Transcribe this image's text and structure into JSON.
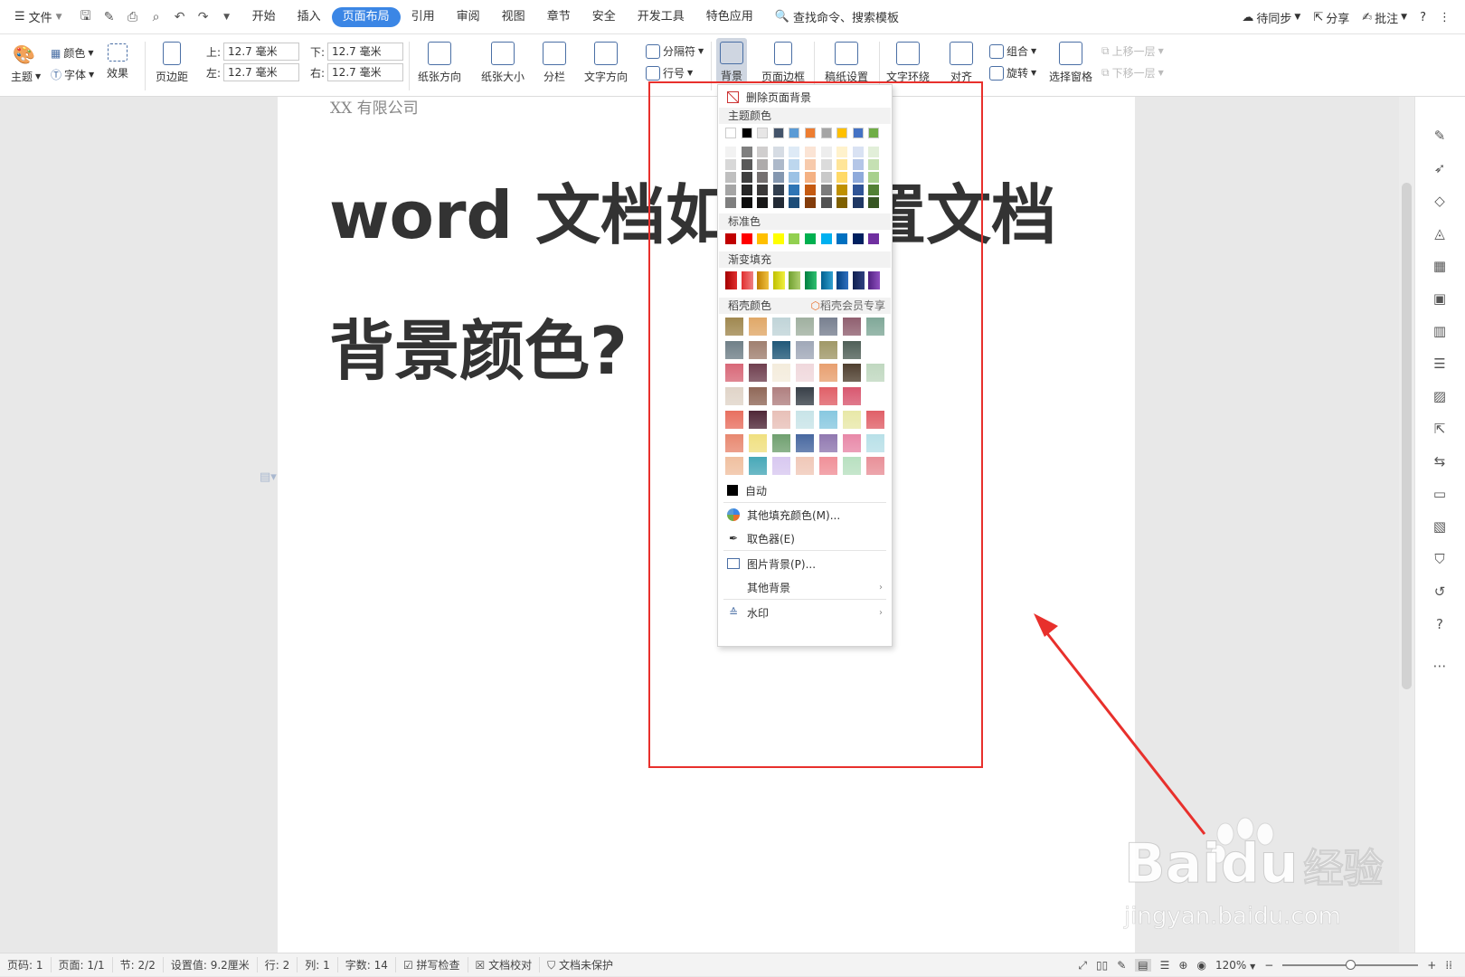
{
  "menubar": {
    "file_label": "文件",
    "tabs": [
      "开始",
      "插入",
      "页面布局",
      "引用",
      "审阅",
      "视图",
      "章节",
      "安全",
      "开发工具",
      "特色应用"
    ],
    "active_tab": "页面布局",
    "search_label": "查找命令、搜索模板",
    "right": {
      "sync": "待同步",
      "share": "分享",
      "comment": "批注",
      "help": "?",
      "more": "⋮"
    }
  },
  "ribbon": {
    "theme": "主题",
    "color": "颜色",
    "font": "字体",
    "effect": "效果",
    "margins": "页边距",
    "top_label": "上:",
    "top_value": "12.7 毫米",
    "bottom_label": "下:",
    "bottom_value": "12.7 毫米",
    "left_label": "左:",
    "left_value": "12.7 毫米",
    "right_label": "右:",
    "right_value": "12.7 毫米",
    "orientation": "纸张方向",
    "size": "纸张大小",
    "columns": "分栏",
    "text_direction": "文字方向",
    "separator": "分隔符",
    "line_number": "行号",
    "background": "背景",
    "page_border": "页面边框",
    "draft_settings": "稿纸设置",
    "text_wrap": "文字环绕",
    "align": "对齐",
    "group": "组合",
    "rotate": "旋转",
    "selection_pane": "选择窗格",
    "bring_forward": "上移一层",
    "send_backward": "下移一层"
  },
  "document": {
    "company": "XX 有限公司",
    "title_line1": "word 文档如何设置文档",
    "title_line2": "背景颜色?"
  },
  "dropdown": {
    "delete_bg": "删除页面背景",
    "theme_colors_head": "主题颜色",
    "standard_head": "标准色",
    "gradient_head": "渐变填充",
    "docer_head": "稻壳颜色",
    "docer_vip": "稻壳会员专享",
    "auto": "自动",
    "more_fill": "其他填充颜色(M)...",
    "eyedropper": "取色器(E)",
    "picture_bg": "图片背景(P)...",
    "other_bg": "其他背景",
    "watermark": "水印",
    "theme_top_row": [
      "#ffffff",
      "#000000",
      "#e7e6e6",
      "#44546a",
      "#5b9bd5",
      "#ed7d31",
      "#a5a5a5",
      "#ffc000",
      "#4472c4",
      "#70ad47"
    ],
    "theme_shades": [
      [
        "#f2f2f2",
        "#7f7f7f",
        "#d0cece",
        "#d6dce4",
        "#deeaf6",
        "#fbe4d5",
        "#ededed",
        "#fff2cc",
        "#d9e2f3",
        "#e2efd9"
      ],
      [
        "#d8d8d8",
        "#595959",
        "#aeabab",
        "#adb9ca",
        "#bdd7ee",
        "#f7caac",
        "#dbdbdb",
        "#ffe599",
        "#b4c6e7",
        "#c5e0b3"
      ],
      [
        "#bfbfbf",
        "#3f3f3f",
        "#757070",
        "#8497b0",
        "#9cc2e5",
        "#f4b183",
        "#c9c9c9",
        "#ffd966",
        "#8eaadb",
        "#a8d08d"
      ],
      [
        "#a5a5a5",
        "#262626",
        "#3a3838",
        "#323f4f",
        "#2e75b5",
        "#c55a11",
        "#7b7b7b",
        "#bf9000",
        "#2f5496",
        "#538135"
      ],
      [
        "#7f7f7f",
        "#0c0c0c",
        "#171616",
        "#222a35",
        "#1e4e79",
        "#833c0b",
        "#525252",
        "#7f6000",
        "#1f3864",
        "#375623"
      ]
    ],
    "standard_colors": [
      "#c00000",
      "#ff0000",
      "#ffc000",
      "#ffff00",
      "#92d050",
      "#00b050",
      "#00b0f0",
      "#0070c0",
      "#002060",
      "#7030a0"
    ],
    "gradient_colors": [
      [
        "#a50000",
        "#e03030"
      ],
      [
        "#e03030",
        "#f08080"
      ],
      [
        "#c08000",
        "#f0c040"
      ],
      [
        "#c0c000",
        "#f0f040"
      ],
      [
        "#70a030",
        "#b0d070"
      ],
      [
        "#008040",
        "#30c070"
      ],
      [
        "#006090",
        "#30a0d0"
      ],
      [
        "#004080",
        "#3070c0"
      ],
      [
        "#102050",
        "#304080"
      ],
      [
        "#502080",
        "#9050c0"
      ]
    ],
    "docer_colors": [
      [
        "#a08850",
        "#e0a868",
        "#c0d4d8",
        "#a0b0a0",
        "#788090",
        "#906070",
        "#80a898"
      ],
      [
        "#708088",
        "#a08070",
        "#205878",
        "#a0a8b8",
        "#a09868",
        "#506058"
      ],
      [
        "#d86878",
        "#704050",
        "#f4ecdc",
        "#f0d8dc",
        "#e8a070",
        "#504030",
        "#c0d8c0"
      ],
      [
        "#e0d4c8",
        "#906858",
        "#b08080",
        "#384048",
        "#e06068",
        "#d85870"
      ],
      [
        "#e87060",
        "#502838",
        "#e8c0b8",
        "#c8e4e8",
        "#88c8e0",
        "#e8e8a8",
        "#e06068"
      ],
      [
        "#e88870",
        "#f0e080",
        "#70a070",
        "#4868a0",
        "#9078b0",
        "#e888a8",
        "#b8e0e8"
      ],
      [
        "#f0c0a0",
        "#48a8b8",
        "#d8c8f0",
        "#f0c8b8",
        "#f09098",
        "#b8e0c0",
        "#e89098"
      ]
    ]
  },
  "statusbar": {
    "page_code": "页码: 1",
    "pages": "页面: 1/1",
    "section": "节: 2/2",
    "setting": "设置值: 9.2厘米",
    "row": "行: 2",
    "col": "列: 1",
    "words": "字数: 14",
    "spell": "拼写检查",
    "proofread": "文档校对",
    "protect": "文档未保护",
    "zoom": "120%"
  },
  "watermark": {
    "main": "Bai",
    "du": "du",
    "sub": "经验",
    "url": "jingyan.baidu.com"
  }
}
